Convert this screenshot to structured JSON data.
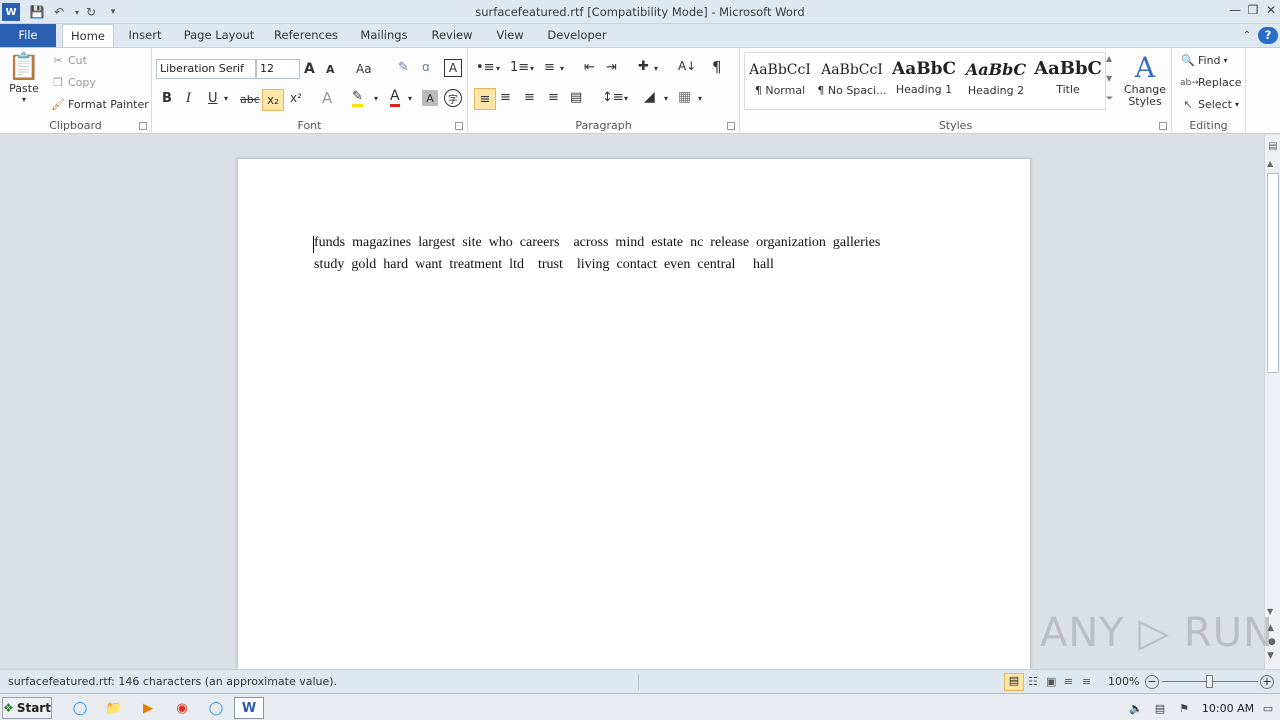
{
  "window": {
    "title": "surfacefeatured.rtf [Compatibility Mode]  -  Microsoft Word",
    "controls": {
      "minimize": "—",
      "restore": "❐",
      "close": "✕"
    }
  },
  "tabs": [
    "File",
    "Home",
    "Insert",
    "Page Layout",
    "References",
    "Mailings",
    "Review",
    "View",
    "Developer"
  ],
  "clipboard": {
    "paste": "Paste",
    "cut": "Cut",
    "copy": "Copy",
    "format_painter": "Format Painter",
    "label": "Clipboard"
  },
  "font": {
    "name": "Liberation Serif",
    "size": "12",
    "label": "Font",
    "bold": "B",
    "italic": "I",
    "underline": "U",
    "strike": "abc",
    "subscript": "x₂",
    "superscript": "x²",
    "change_case": "Aa",
    "grow": "A",
    "shrink": "A"
  },
  "paragraph": {
    "label": "Paragraph",
    "pilcrow": "¶"
  },
  "styles": {
    "label": "Styles",
    "items": [
      {
        "sample": "AaBbCcI",
        "name": "¶ Normal"
      },
      {
        "sample": "AaBbCcI",
        "name": "¶ No Spaci..."
      },
      {
        "sample": "AaBbC",
        "name": "Heading 1"
      },
      {
        "sample": "AaBbC",
        "name": "Heading 2"
      },
      {
        "sample": "AaBbC",
        "name": "Title"
      }
    ],
    "change_styles": "Change Styles"
  },
  "editing": {
    "label": "Editing",
    "find": "Find",
    "replace": "Replace",
    "select": "Select"
  },
  "document": {
    "lines": [
      "funds  magazines  largest  site  who  careers    across  mind  estate  nc  release  organization  galleries",
      "study  gold  hard  want  treatment  ltd    trust    living  contact  even  central     hall"
    ]
  },
  "status": {
    "text": "surfacefeatured.rtf: 146 characters (an approximate value).",
    "zoom": "100%"
  },
  "taskbar": {
    "start": "Start",
    "clock": "10:00 AM"
  },
  "watermark": "ANY ▷ RUN"
}
